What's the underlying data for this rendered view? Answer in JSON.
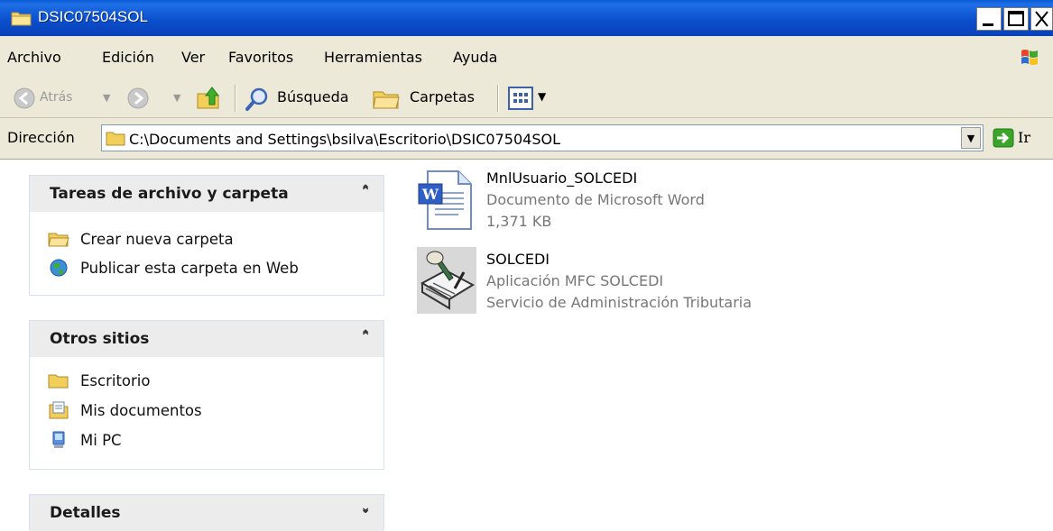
{
  "window": {
    "title": "DSIC07504SOL"
  },
  "menu": {
    "items": [
      "Archivo",
      "Edición",
      "Ver",
      "Favoritos",
      "Herramientas",
      "Ayuda"
    ]
  },
  "toolbar": {
    "back_label": "Atrás",
    "search_label": "Búsqueda",
    "folders_label": "Carpetas"
  },
  "address": {
    "label": "Dirección",
    "path": "C:\\Documents and Settings\\bsilva\\Escritorio\\DSIC07504SOL",
    "go_label": "Ir"
  },
  "panels": {
    "tasks": {
      "title": "Tareas de archivo y carpeta",
      "items": [
        "Crear nueva carpeta",
        "Publicar esta carpeta en Web"
      ]
    },
    "other": {
      "title": "Otros sitios",
      "items": [
        "Escritorio",
        "Mis documentos",
        "Mi PC"
      ]
    },
    "details": {
      "title": "Detalles"
    }
  },
  "files": [
    {
      "name": "MnlUsuario_SOLCEDI",
      "type": "Documento de Microsoft Word",
      "size": "1,371 KB",
      "icon": "word-document-icon"
    },
    {
      "name": "SOLCEDI",
      "type": "Aplicación MFC SOLCEDI",
      "company": "Servicio de Administración Tributaria",
      "icon": "application-icon"
    }
  ]
}
